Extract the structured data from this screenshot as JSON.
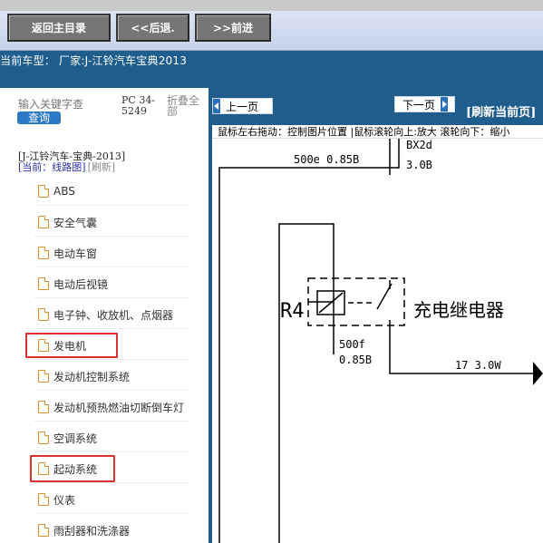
{
  "nav": {
    "home": "返回主目录",
    "back": "<<后退.",
    "forward": ">>前进"
  },
  "car_info": "当前车型： 厂家:J-江铃汽车宝典2013",
  "left": {
    "search_placeholder": "输入关键字查",
    "query": "查询",
    "pc_label": "PC 34-5249",
    "fold": "折叠全部",
    "crumb": "[J-江铃汽车-宝典-2013]",
    "current": "[当前：线路图]",
    "refresh": "[刷新]",
    "items": [
      {
        "label": "ABS"
      },
      {
        "label": "安全气囊"
      },
      {
        "label": "电动车窗"
      },
      {
        "label": "电动后视镜"
      },
      {
        "label": "电子钟、收放机、点烟器"
      },
      {
        "label": "发电机"
      },
      {
        "label": "发动机控制系统"
      },
      {
        "label": "发动机预热燃油切断倒车灯"
      },
      {
        "label": "空调系统"
      },
      {
        "label": "起动系统"
      },
      {
        "label": "仪表"
      },
      {
        "label": "雨刮器和洗涤器"
      }
    ]
  },
  "right": {
    "prev": "上一页",
    "next": "下一页",
    "refresh_page": "[刷新当前页]",
    "hint": "鼠标左右拖动：控制图片位置 |鼠标滚轮向上:放大  滚轮向下：缩小"
  },
  "diagram": {
    "w1": "500e 0.85B",
    "w2": "BX2d",
    "w3": "3.0B",
    "relay_id": "R4",
    "relay_name": "充电继电器",
    "w4": "500f",
    "w5": "0.85B",
    "w6": "17 3.0W"
  },
  "colors": {
    "accent_blue": "#1f5d8d",
    "button_gray": "#767676",
    "highlight_red": "#e0302e",
    "doc_icon": "#e09030"
  }
}
